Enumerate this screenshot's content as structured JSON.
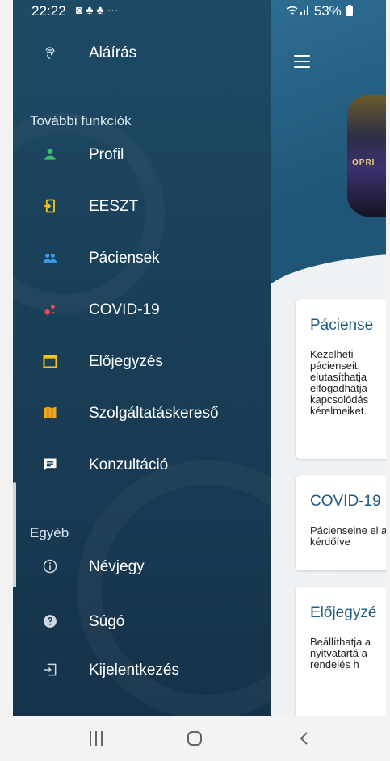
{
  "status": {
    "time": "22:22",
    "left_icons": "◙ ♣ ♣ ···",
    "battery": "53%"
  },
  "drawer": {
    "top_item": {
      "label": "Aláírás",
      "icon": "fingerprint-icon"
    },
    "section_more": "További funkciók",
    "items": [
      {
        "label": "Profil",
        "icon": "person-icon",
        "color": "#3dbb6f"
      },
      {
        "label": "EESZT",
        "icon": "exit-door-icon",
        "color": "#f3c51c"
      },
      {
        "label": "Páciensek",
        "icon": "people-icon",
        "color": "#3a9be6"
      },
      {
        "label": "COVID-19",
        "icon": "covid-icon",
        "color": "#e8474e"
      },
      {
        "label": "Előjegyzés",
        "icon": "calendar-icon",
        "color": "#f3c51c"
      },
      {
        "label": "Szolgáltatáskereső",
        "icon": "map-icon",
        "color": "#f3a51c"
      },
      {
        "label": "Konzultáció",
        "icon": "chat-icon",
        "color": "#ffffff"
      }
    ],
    "section_other": "Egyéb",
    "other_items": [
      {
        "label": "Névjegy",
        "icon": "info-icon"
      },
      {
        "label": "Súgó",
        "icon": "help-icon"
      },
      {
        "label": "Kijelentkezés",
        "icon": "logout-icon"
      }
    ]
  },
  "app": {
    "poster_text": "OPRI",
    "cards": [
      {
        "title": "Páciense",
        "text": "Kezelheti pácienseit, elutasíthatja elfogadhatja kapcsolódás kérelmeiket."
      },
      {
        "title": "COVID-19",
        "text": "Pácienseine el a kérdőíve"
      },
      {
        "title": "Előjegyzé",
        "text": "Beállíthatja a nyitvatartá a rendelés h"
      }
    ]
  },
  "colors": {
    "drawer_bg": "#1c4460",
    "accent": "#1f5a7c"
  }
}
